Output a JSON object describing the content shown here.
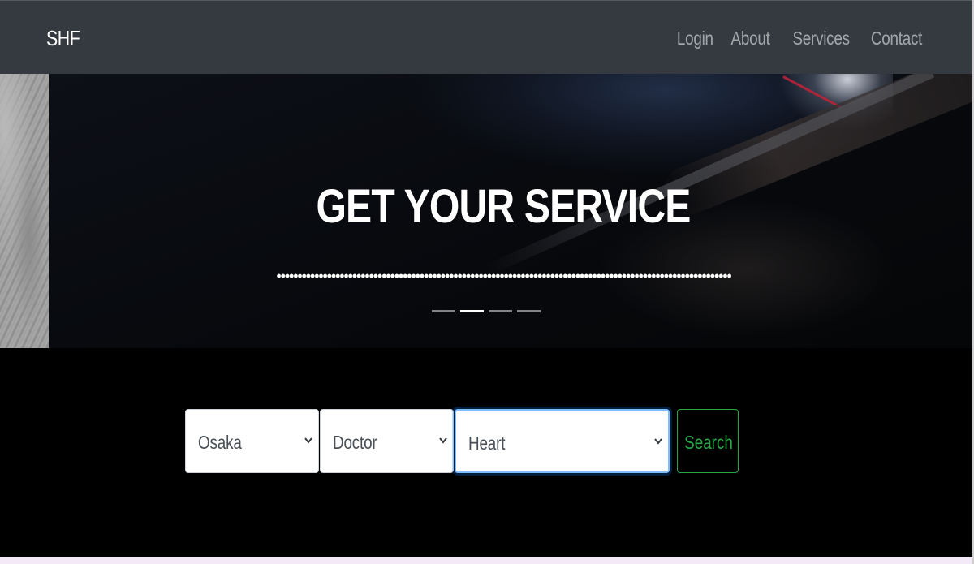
{
  "navbar": {
    "brand": "SHF",
    "links": [
      {
        "label": "Login"
      },
      {
        "label": "About"
      },
      {
        "label": "Services"
      },
      {
        "label": "Contact"
      }
    ]
  },
  "hero": {
    "title": "GET YOUR SERVICE",
    "slide_count": 4,
    "active_slide": 2
  },
  "search": {
    "city": "Osaka",
    "provider_type": "Doctor",
    "specialty": "Heart",
    "button_label": "Search"
  },
  "colors": {
    "navbar_bg": "#343a40",
    "page_bg": "#000000",
    "search_accent": "#28a745",
    "focus_border": "#80bdff"
  }
}
